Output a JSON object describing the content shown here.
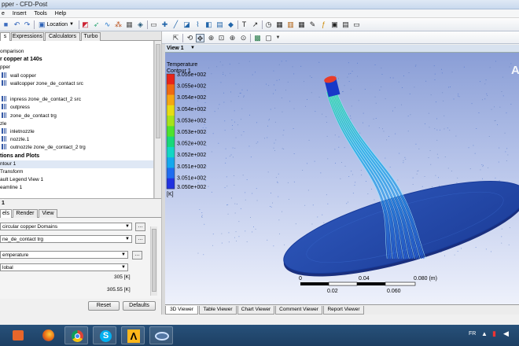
{
  "window": {
    "title": "pper - CFD-Post"
  },
  "menu": [
    "e",
    "Insert",
    "Tools",
    "Help"
  ],
  "toolbar": {
    "location_label": "Location"
  },
  "left_tabs": [
    "s",
    "Expressions",
    "Calculators",
    "Turbo"
  ],
  "tree": [
    {
      "text": "omparison",
      "kind": "plain"
    },
    {
      "text": "r copper at 140s",
      "kind": "hdr"
    },
    {
      "text": "pper",
      "kind": "plain"
    },
    {
      "text": "wall copper",
      "kind": "item"
    },
    {
      "text": "wallcopper zone_de_contact src",
      "kind": "item"
    },
    {
      "text": "",
      "kind": "gap"
    },
    {
      "text": "inpress zone_de_contact_2 src",
      "kind": "item"
    },
    {
      "text": "outpress",
      "kind": "item"
    },
    {
      "text": "zone_de_contact trg",
      "kind": "item"
    },
    {
      "text": "zle",
      "kind": "plain"
    },
    {
      "text": "inletnozzle",
      "kind": "item"
    },
    {
      "text": "nozzle.1",
      "kind": "item"
    },
    {
      "text": "outnozzle zone_de_contact_2 trg",
      "kind": "item"
    },
    {
      "text": "tions and Plots",
      "kind": "hdr"
    },
    {
      "text": "ntour 1",
      "kind": "sel"
    },
    {
      "text": "Transform",
      "kind": "plain"
    },
    {
      "text": "ault Legend View 1",
      "kind": "plain"
    },
    {
      "text": "eamline 1",
      "kind": "plain"
    }
  ],
  "details": {
    "title": "1",
    "tabs": [
      "els",
      "Render",
      "View"
    ],
    "domains": "circular copper Domains",
    "location": "ne_de_contact trg",
    "variable": "emperature",
    "range": "lobal",
    "min_value": "305 [K]",
    "max_value": "305.55 [K]",
    "reset_label": "Reset",
    "defaults_label": "Defaults"
  },
  "viewer": {
    "view_label": "View 1",
    "corner_letter": "A",
    "legend_title": "Temperature",
    "legend_sub": "Contour 1",
    "legend_values": [
      "3.055e+002",
      "3.055e+002",
      "3.054e+002",
      "3.054e+002",
      "3.053e+002",
      "3.053e+002",
      "3.052e+002",
      "3.052e+002",
      "3.051e+002",
      "3.051e+002",
      "3.050e+002"
    ],
    "legend_unit": "[K]",
    "legend_colors": [
      "#e8241a",
      "#ef6a12",
      "#f4a712",
      "#e7dc12",
      "#a6e21a",
      "#4ee22e",
      "#18d87a",
      "#12d6c4",
      "#14a8ee",
      "#1f6cf0",
      "#2132e0"
    ],
    "scale_top": [
      "0",
      "0.04",
      "0.080  (m)"
    ],
    "scale_bottom": [
      "0.02",
      "0.060"
    ],
    "tabs": [
      "3D Viewer",
      "Table Viewer",
      "Chart Viewer",
      "Comment Viewer",
      "Report Viewer"
    ]
  },
  "taskbar": {
    "lang": "FR"
  }
}
